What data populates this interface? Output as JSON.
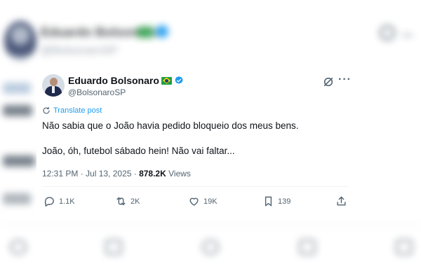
{
  "background_post": {
    "author_name": "Eduardo Bolsonaro",
    "handle": "@BolsonaroSP"
  },
  "tweet": {
    "author": {
      "name": "Eduardo Bolsonaro",
      "handle": "@BolsonaroSP",
      "flag": "brazil-flag",
      "verified": true
    },
    "translate_label": "Translate post",
    "text_line1": "Não sabia que o João havia pedido bloqueio dos meus bens.",
    "text_line2": "João, óh, futebol sábado hein! Não vai faltar...",
    "timestamp": "12:31 PM · Jul 13, 2025 · ",
    "views_count": "878.2K",
    "views_label": " Views",
    "actions": {
      "replies": "1.1K",
      "reposts": "2K",
      "likes": "19K",
      "bookmarks": "139"
    }
  },
  "colors": {
    "accent": "#1d9bf0",
    "text": "#0f1419",
    "secondary": "#536471"
  }
}
